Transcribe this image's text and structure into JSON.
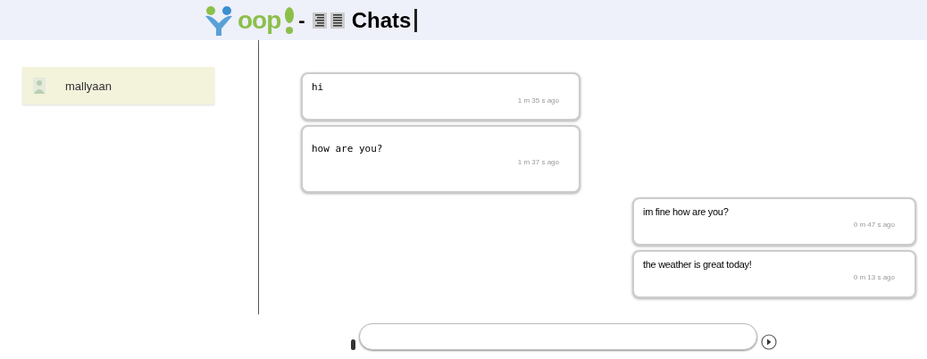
{
  "header": {
    "logo_text": "oop",
    "separator": "-",
    "title": "Chats"
  },
  "contacts": [
    {
      "name": "mallyaan",
      "selected": true
    }
  ],
  "messages": [
    {
      "kind": "incoming",
      "text": "hi",
      "time": "1 m 35 s ago"
    },
    {
      "kind": "incoming",
      "text": "how are you?",
      "time": "1 m 37 s ago"
    },
    {
      "kind": "outgoing",
      "text": "im fine how are you?",
      "time": "0 m 47 s ago"
    },
    {
      "kind": "outgoing",
      "text": "the weather is great today!",
      "time": "0 m 13 s ago"
    }
  ]
}
